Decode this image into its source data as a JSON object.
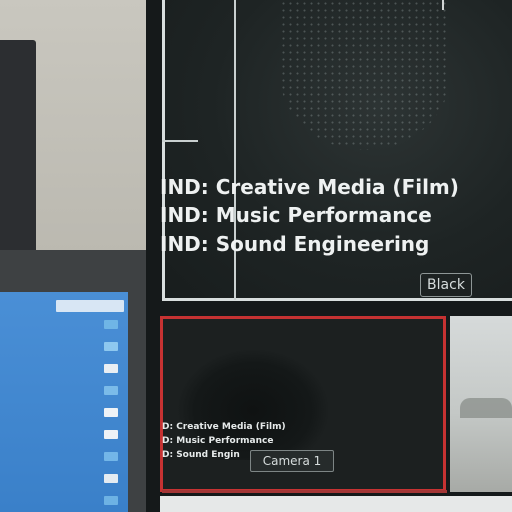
{
  "program": {
    "titles": [
      "IND: Creative Media (Film)",
      "IND: Music Performance",
      "IND: Sound Engineering"
    ],
    "black_button": "Black"
  },
  "preview": {
    "titles": [
      "D: Creative Media (Film)",
      "D: Music Performance",
      "D: Sound Engin"
    ],
    "camera_label": "Camera 1"
  },
  "colors": {
    "preview_border": "#c63232",
    "laptop_screen": "#3a80c9"
  }
}
